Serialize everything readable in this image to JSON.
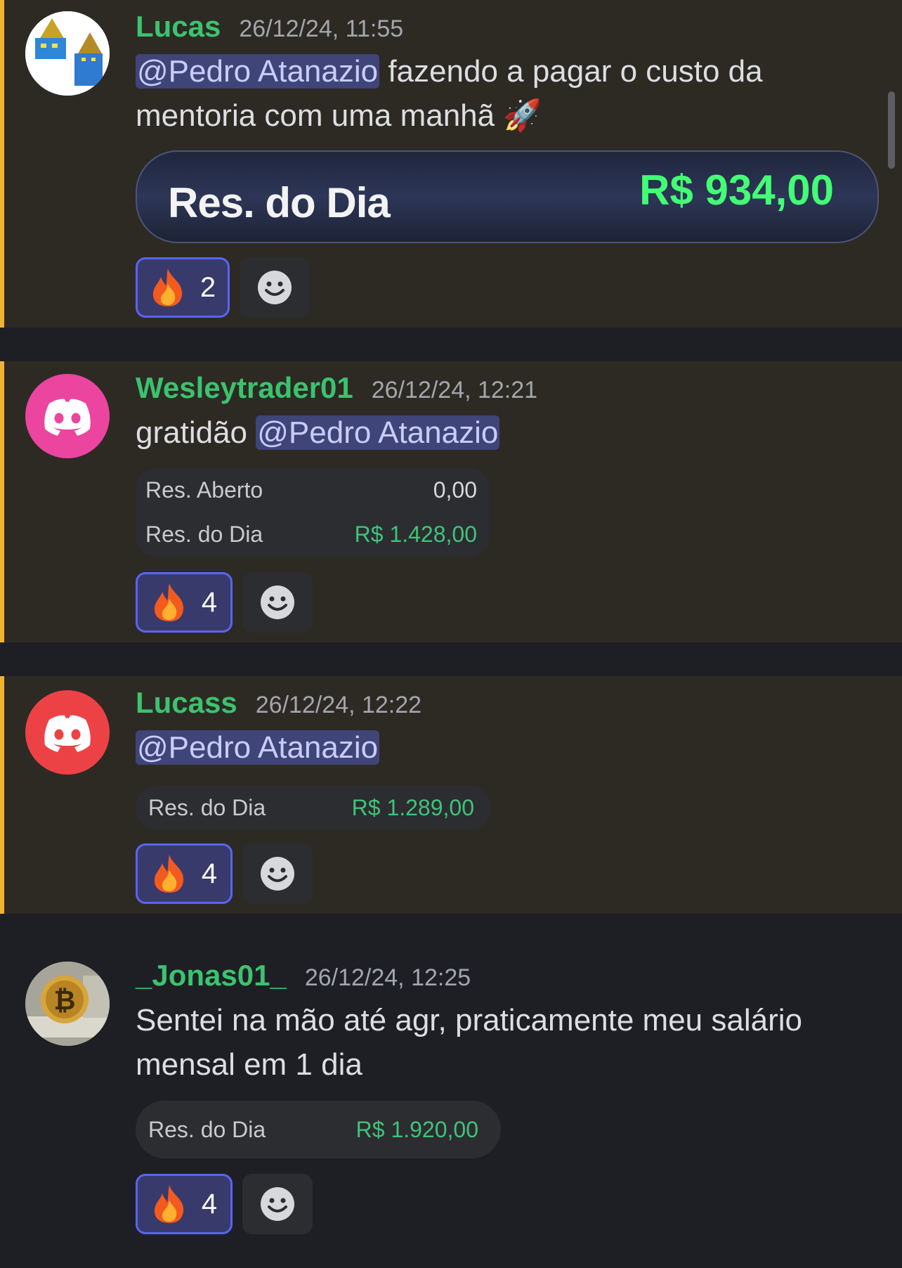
{
  "messages": [
    {
      "author": "Lucas",
      "time": "26/12/24, 11:55",
      "mention": "@Pedro Atanazio",
      "text": " fazendo a pagar o custo da mentoria com uma manhã 🚀",
      "image": {
        "label": "Res. do Dia",
        "value": "R$ 934,00"
      },
      "reaction": {
        "emoji": "fire",
        "count": "2"
      }
    },
    {
      "author": "Wesleytrader01",
      "time": "26/12/24, 12:21",
      "text_before": "gratidão ",
      "mention": "@Pedro Atanazio",
      "pane": {
        "row1_label": "Res. Aberto",
        "row1_value": "0,00",
        "row2_label": "Res. do Dia",
        "row2_value": "R$ 1.428,00"
      },
      "reaction": {
        "emoji": "fire",
        "count": "4"
      }
    },
    {
      "author": "Lucass",
      "time": "26/12/24, 12:22",
      "mention": "@Pedro Atanazio",
      "pane": {
        "label": "Res. do Dia",
        "value": "R$ 1.289,00"
      },
      "reaction": {
        "emoji": "fire",
        "count": "4"
      }
    },
    {
      "author": "_Jonas01_",
      "time": "26/12/24, 12:25",
      "text": "Sentei na mão até agr, praticamente meu salário mensal em 1 dia",
      "pane": {
        "label": "Res. do Dia",
        "value": "R$ 1.920,00"
      },
      "reaction": {
        "emoji": "fire",
        "count": "4"
      }
    }
  ],
  "colors": {
    "author": "#3bc36e",
    "mention_bg": "#3f4479",
    "highlight_bg": "#2d2a24",
    "highlight_bar": "#f0b232",
    "profit_green": "#3fc37a"
  },
  "icons": [
    "fire-icon",
    "add-reaction-icon",
    "discord-logo-icon",
    "rocket-icon"
  ]
}
